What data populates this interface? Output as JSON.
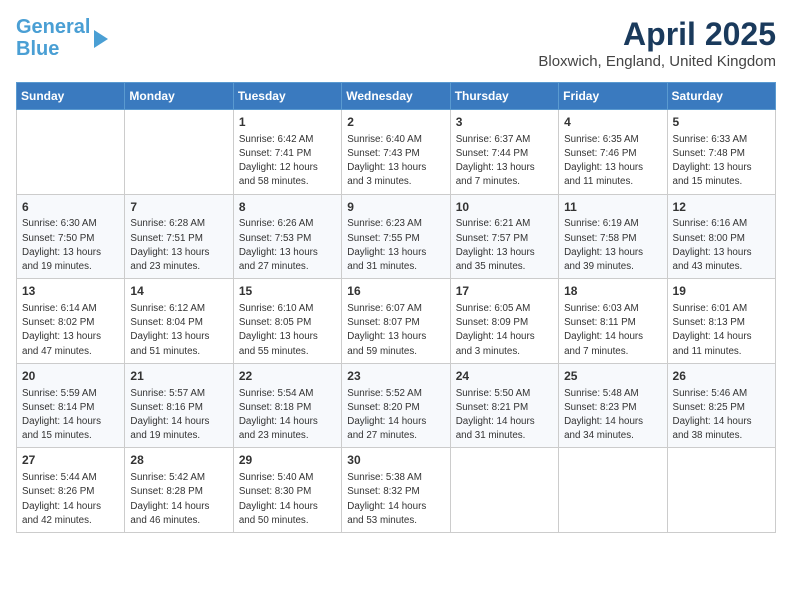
{
  "logo": {
    "line1": "General",
    "line2": "Blue"
  },
  "title": "April 2025",
  "subtitle": "Bloxwich, England, United Kingdom",
  "days_of_week": [
    "Sunday",
    "Monday",
    "Tuesday",
    "Wednesday",
    "Thursday",
    "Friday",
    "Saturday"
  ],
  "weeks": [
    [
      {
        "day": "",
        "info": ""
      },
      {
        "day": "",
        "info": ""
      },
      {
        "day": "1",
        "info": "Sunrise: 6:42 AM\nSunset: 7:41 PM\nDaylight: 12 hours and 58 minutes."
      },
      {
        "day": "2",
        "info": "Sunrise: 6:40 AM\nSunset: 7:43 PM\nDaylight: 13 hours and 3 minutes."
      },
      {
        "day": "3",
        "info": "Sunrise: 6:37 AM\nSunset: 7:44 PM\nDaylight: 13 hours and 7 minutes."
      },
      {
        "day": "4",
        "info": "Sunrise: 6:35 AM\nSunset: 7:46 PM\nDaylight: 13 hours and 11 minutes."
      },
      {
        "day": "5",
        "info": "Sunrise: 6:33 AM\nSunset: 7:48 PM\nDaylight: 13 hours and 15 minutes."
      }
    ],
    [
      {
        "day": "6",
        "info": "Sunrise: 6:30 AM\nSunset: 7:50 PM\nDaylight: 13 hours and 19 minutes."
      },
      {
        "day": "7",
        "info": "Sunrise: 6:28 AM\nSunset: 7:51 PM\nDaylight: 13 hours and 23 minutes."
      },
      {
        "day": "8",
        "info": "Sunrise: 6:26 AM\nSunset: 7:53 PM\nDaylight: 13 hours and 27 minutes."
      },
      {
        "day": "9",
        "info": "Sunrise: 6:23 AM\nSunset: 7:55 PM\nDaylight: 13 hours and 31 minutes."
      },
      {
        "day": "10",
        "info": "Sunrise: 6:21 AM\nSunset: 7:57 PM\nDaylight: 13 hours and 35 minutes."
      },
      {
        "day": "11",
        "info": "Sunrise: 6:19 AM\nSunset: 7:58 PM\nDaylight: 13 hours and 39 minutes."
      },
      {
        "day": "12",
        "info": "Sunrise: 6:16 AM\nSunset: 8:00 PM\nDaylight: 13 hours and 43 minutes."
      }
    ],
    [
      {
        "day": "13",
        "info": "Sunrise: 6:14 AM\nSunset: 8:02 PM\nDaylight: 13 hours and 47 minutes."
      },
      {
        "day": "14",
        "info": "Sunrise: 6:12 AM\nSunset: 8:04 PM\nDaylight: 13 hours and 51 minutes."
      },
      {
        "day": "15",
        "info": "Sunrise: 6:10 AM\nSunset: 8:05 PM\nDaylight: 13 hours and 55 minutes."
      },
      {
        "day": "16",
        "info": "Sunrise: 6:07 AM\nSunset: 8:07 PM\nDaylight: 13 hours and 59 minutes."
      },
      {
        "day": "17",
        "info": "Sunrise: 6:05 AM\nSunset: 8:09 PM\nDaylight: 14 hours and 3 minutes."
      },
      {
        "day": "18",
        "info": "Sunrise: 6:03 AM\nSunset: 8:11 PM\nDaylight: 14 hours and 7 minutes."
      },
      {
        "day": "19",
        "info": "Sunrise: 6:01 AM\nSunset: 8:13 PM\nDaylight: 14 hours and 11 minutes."
      }
    ],
    [
      {
        "day": "20",
        "info": "Sunrise: 5:59 AM\nSunset: 8:14 PM\nDaylight: 14 hours and 15 minutes."
      },
      {
        "day": "21",
        "info": "Sunrise: 5:57 AM\nSunset: 8:16 PM\nDaylight: 14 hours and 19 minutes."
      },
      {
        "day": "22",
        "info": "Sunrise: 5:54 AM\nSunset: 8:18 PM\nDaylight: 14 hours and 23 minutes."
      },
      {
        "day": "23",
        "info": "Sunrise: 5:52 AM\nSunset: 8:20 PM\nDaylight: 14 hours and 27 minutes."
      },
      {
        "day": "24",
        "info": "Sunrise: 5:50 AM\nSunset: 8:21 PM\nDaylight: 14 hours and 31 minutes."
      },
      {
        "day": "25",
        "info": "Sunrise: 5:48 AM\nSunset: 8:23 PM\nDaylight: 14 hours and 34 minutes."
      },
      {
        "day": "26",
        "info": "Sunrise: 5:46 AM\nSunset: 8:25 PM\nDaylight: 14 hours and 38 minutes."
      }
    ],
    [
      {
        "day": "27",
        "info": "Sunrise: 5:44 AM\nSunset: 8:26 PM\nDaylight: 14 hours and 42 minutes."
      },
      {
        "day": "28",
        "info": "Sunrise: 5:42 AM\nSunset: 8:28 PM\nDaylight: 14 hours and 46 minutes."
      },
      {
        "day": "29",
        "info": "Sunrise: 5:40 AM\nSunset: 8:30 PM\nDaylight: 14 hours and 50 minutes."
      },
      {
        "day": "30",
        "info": "Sunrise: 5:38 AM\nSunset: 8:32 PM\nDaylight: 14 hours and 53 minutes."
      },
      {
        "day": "",
        "info": ""
      },
      {
        "day": "",
        "info": ""
      },
      {
        "day": "",
        "info": ""
      }
    ]
  ]
}
